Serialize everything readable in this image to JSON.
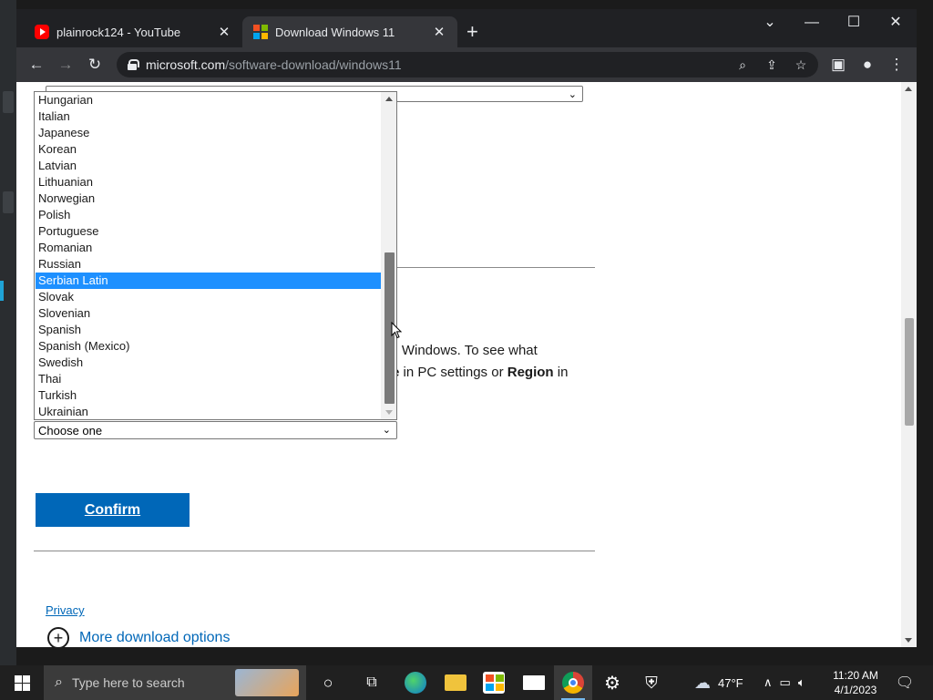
{
  "browser": {
    "tabs": [
      {
        "title": "plainrock124 - YouTube",
        "favicon": "youtube-icon",
        "active": false
      },
      {
        "title": "Download Windows 11",
        "favicon": "microsoft-icon",
        "active": true
      }
    ],
    "url_host": "microsoft.com",
    "url_path": "/software-download/windows11"
  },
  "page": {
    "top_select_value": "",
    "paragraph_line1_end": "ll Windows. To see what",
    "paragraph_line2_bold1": "e",
    "paragraph_line2_mid": " in PC settings or ",
    "paragraph_line2_bold2": "Region",
    "paragraph_line2_end": " in",
    "language_select_value": "Choose one",
    "confirm_label": "Confirm",
    "privacy_label": "Privacy",
    "more_options_label": "More download options"
  },
  "dropdown": {
    "options": [
      "Hungarian",
      "Italian",
      "Japanese",
      "Korean",
      "Latvian",
      "Lithuanian",
      "Norwegian",
      "Polish",
      "Portuguese",
      "Romanian",
      "Russian",
      "Serbian Latin",
      "Slovak",
      "Slovenian",
      "Spanish",
      "Spanish (Mexico)",
      "Swedish",
      "Thai",
      "Turkish",
      "Ukrainian"
    ],
    "selected": "Serbian Latin"
  },
  "taskbar": {
    "search_placeholder": "Type here to search",
    "weather": "47°F",
    "time": "11:20 AM",
    "date": "4/1/2023"
  },
  "colors": {
    "confirm_bg": "#0067b8",
    "selection_bg": "#1e90ff",
    "link": "#0067b8"
  }
}
